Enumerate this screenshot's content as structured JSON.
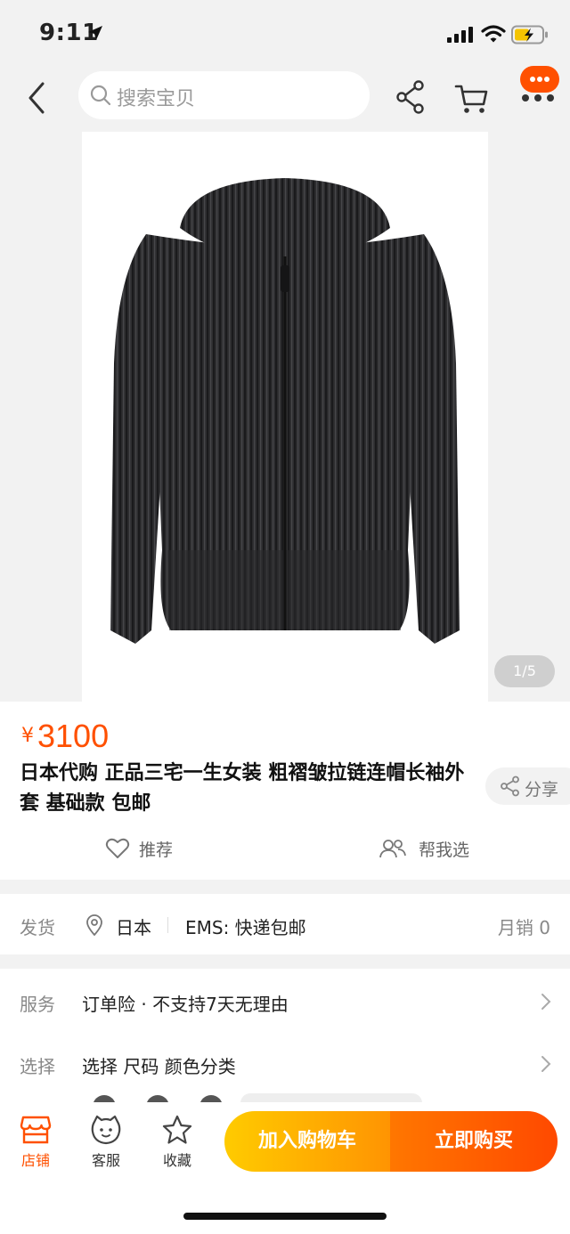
{
  "status_bar": {
    "time": "9:11"
  },
  "search": {
    "placeholder": "搜索宝贝"
  },
  "gallery": {
    "counter": "1/5"
  },
  "product": {
    "price_symbol": "¥",
    "price": "3100",
    "title": "日本代购 正品三宅一生女装 粗褶皱拉链连帽长袖外套 基础款 包邮",
    "share_label": "分享",
    "recommend_label": "推荐",
    "help_choose_label": "帮我选"
  },
  "shipping": {
    "label": "发货",
    "origin": "日本",
    "method": "EMS: 快递包邮",
    "monthly_sales": "月销 0"
  },
  "service": {
    "label": "服务",
    "value": "订单险 · 不支持7天无理由"
  },
  "choose": {
    "label": "选择",
    "value": "选择  尺码 颜色分类"
  },
  "bottom_bar": {
    "store_label": "店铺",
    "service_label": "客服",
    "favorite_label": "收藏",
    "add_to_cart_label": "加入购物车",
    "buy_now_label": "立即购买"
  },
  "colors": {
    "accent": "#ff5000",
    "cart_gradient_start": "#ffcb00",
    "buy_gradient_end": "#ff4900"
  },
  "icons": [
    "location-arrow-icon",
    "signal-icon",
    "wifi-icon",
    "battery-icon",
    "back-icon",
    "search-icon",
    "share-icon",
    "cart-icon",
    "more-icon",
    "heart-icon",
    "people-icon",
    "pin-icon",
    "chevron-right-icon",
    "store-icon",
    "service-face-icon",
    "star-icon"
  ]
}
